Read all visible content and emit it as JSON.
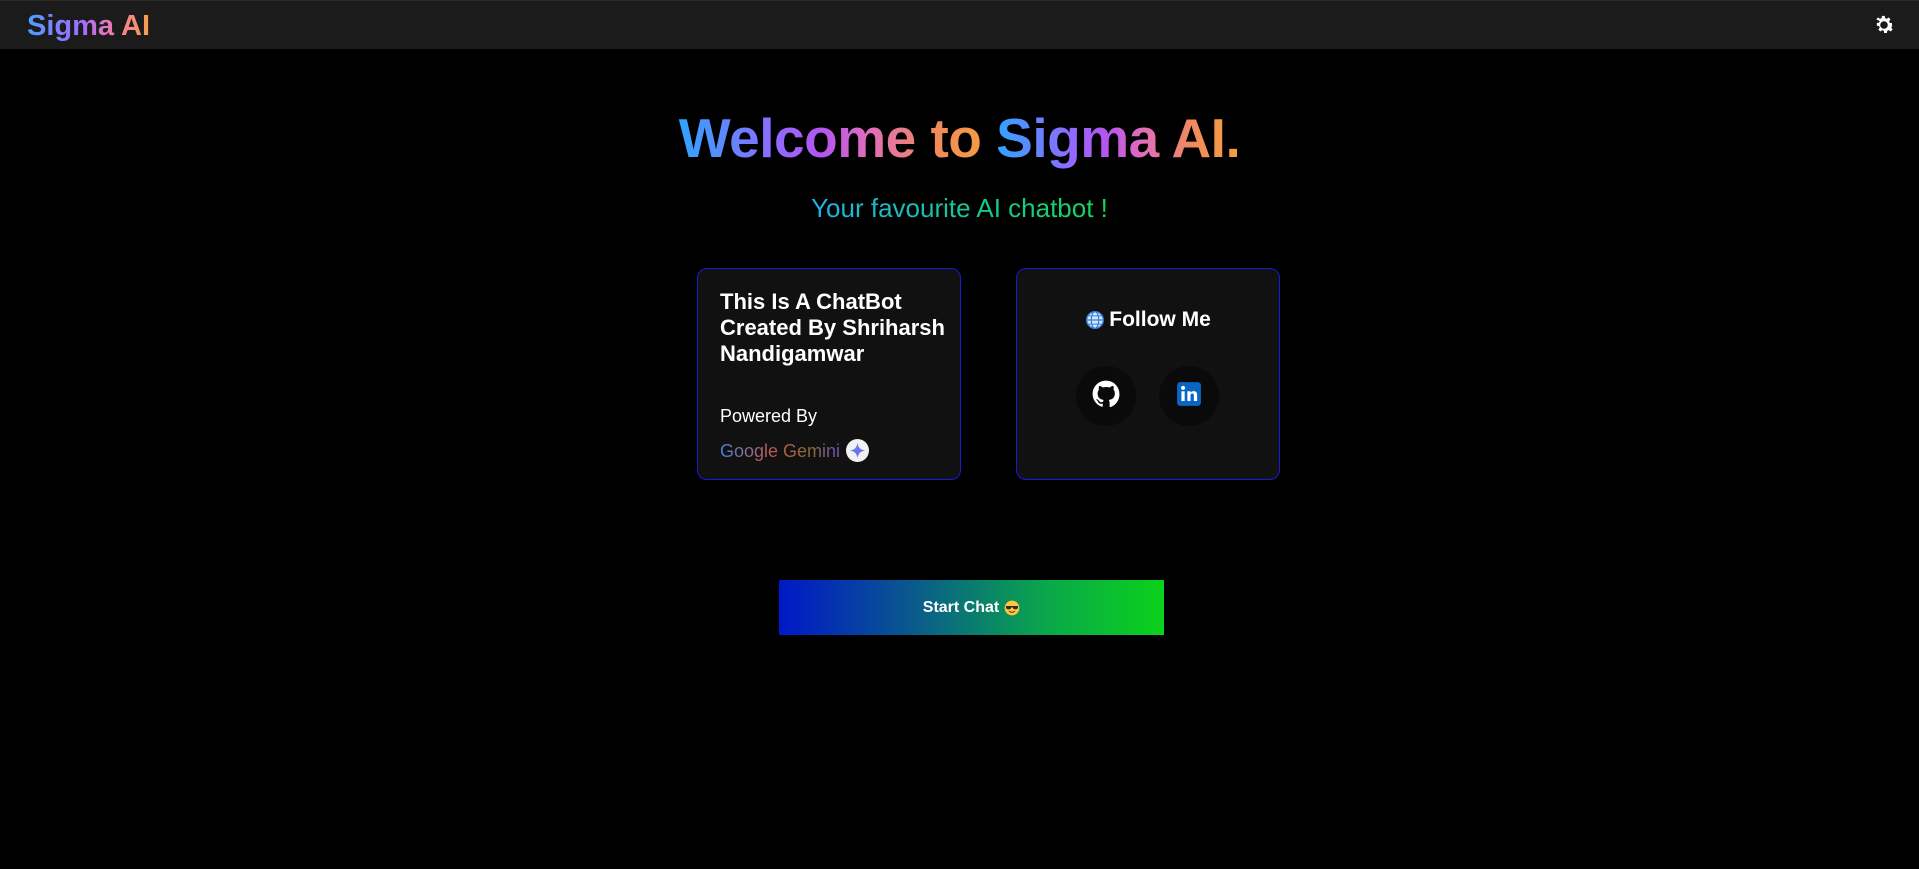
{
  "navbar": {
    "brand": "Sigma AI",
    "theme_toggle_icon": "gear-icon"
  },
  "hero": {
    "title_prefix": "Welcome to ",
    "title_brand": "Sigma AI.",
    "subtitle": "Your favourite AI chatbot !"
  },
  "about_card": {
    "title": "This Is A ChatBot Created By Shriharsh Nandigamwar",
    "powered_by_label": "Powered By",
    "powered_by_name": "Google Gemini",
    "powered_by_icon": "gemini-logo-icon"
  },
  "follow_card": {
    "title": "Follow Me",
    "title_icon": "globe-icon",
    "links": [
      {
        "icon": "github-icon"
      },
      {
        "icon": "linkedin-icon"
      }
    ]
  },
  "cta": {
    "label": "Start Chat",
    "icon": "sunglasses-emoji-icon"
  },
  "colors": {
    "background": "#000000",
    "navbar": "#1b1b1b",
    "card_bg": "#111111",
    "card_border": "#1a1ad0",
    "cta_gradient_start": "#0018c8",
    "cta_gradient_end": "#0ad21a"
  }
}
